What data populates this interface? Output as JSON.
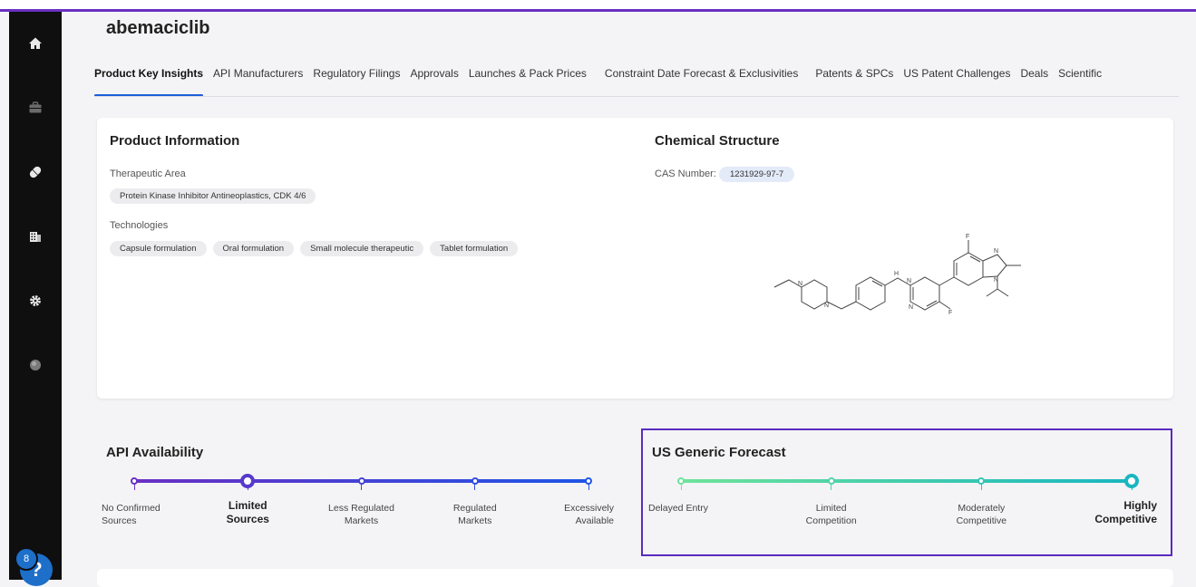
{
  "product": {
    "title": "abemaciclib"
  },
  "tabs": [
    "Product Key Insights",
    "API Manufacturers",
    "Regulatory Filings",
    "Approvals",
    "Launches & Pack Prices",
    "Constraint Date Forecast & Exclusivities",
    "Patents & SPCs",
    "US Patent Challenges",
    "Deals",
    "Scientific"
  ],
  "product_info": {
    "heading": "Product Information",
    "therapeutic_area_label": "Therapeutic Area",
    "therapeutic_area_value": "Protein Kinase Inhibitor Antineoplastics, CDK 4/6",
    "technologies_label": "Technologies",
    "technologies": [
      "Capsule formulation",
      "Oral formulation",
      "Small molecule therapeutic",
      "Tablet formulation"
    ]
  },
  "chemical_structure": {
    "heading": "Chemical Structure",
    "cas_label": "CAS Number:",
    "cas_value": "1231929-97-7"
  },
  "api_availability": {
    "heading": "API Availability",
    "steps": [
      {
        "line1": "No Confirmed",
        "line2": "Sources"
      },
      {
        "line1": "Limited",
        "line2": "Sources"
      },
      {
        "line1": "Less Regulated",
        "line2": "Markets"
      },
      {
        "line1": "Regulated",
        "line2": "Markets"
      },
      {
        "line1": "Excessively",
        "line2": "Available"
      }
    ],
    "selected_index": 1,
    "colors": {
      "start": "#6a2fc4",
      "end": "#1f55e6"
    }
  },
  "us_generic_forecast": {
    "heading": "US Generic Forecast",
    "steps": [
      {
        "line1": "Delayed Entry",
        "line2": ""
      },
      {
        "line1": "Limited",
        "line2": "Competition"
      },
      {
        "line1": "Moderately",
        "line2": "Competitive"
      },
      {
        "line1": "Highly",
        "line2": "Competitive"
      }
    ],
    "selected_index": 3,
    "colors": {
      "start": "#6ee39a",
      "end": "#19b6c0"
    }
  },
  "help": {
    "badge_count": "8",
    "label": "?"
  },
  "icons": [
    "home-icon",
    "briefcase-icon",
    "pill-icon",
    "building-icon",
    "gear-icon",
    "globe-icon",
    "help-icon"
  ]
}
